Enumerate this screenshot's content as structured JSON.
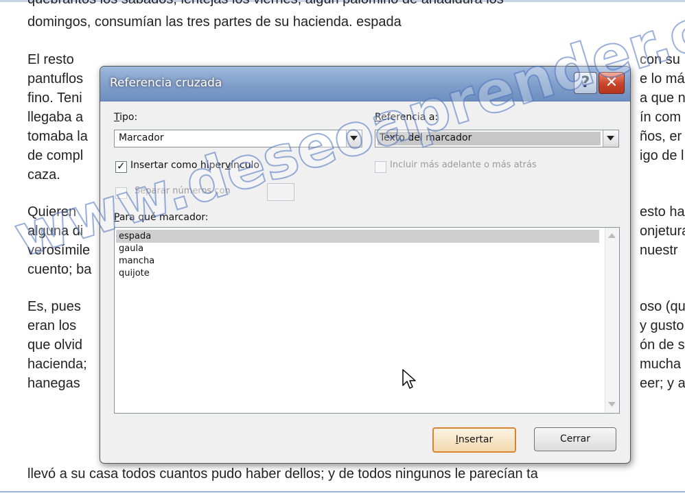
{
  "document": {
    "lines": [
      "quebrantos los sábados, lentejas los viernes, algún palomino de añadidura los",
      "domingos, consumían las tres partes de su hacienda. espada",
      "El resto",
      "con su",
      "pantuflos",
      "e lo más",
      "fino. Teni",
      "a que n",
      "llegaba a",
      "ín com",
      "tomaba la",
      "ños, er",
      "de compl",
      "igo de l",
      "caza.",
      "Quieren",
      "esto ha",
      "alguna di",
      "onjetura",
      "verosímile",
      "nuestr",
      "cuento; ba",
      "Es, pues",
      "oso (qu",
      "eran los",
      "y gusto",
      "que olvid",
      "ón de s",
      "hacienda;",
      "mucha",
      "hanegas",
      "eer; y a",
      "llevó a su casa todos cuantos pudo haber dellos; y de todos ningunos le parecían ta"
    ]
  },
  "dialog": {
    "title": "Referencia cruzada",
    "help_glyph": "?",
    "close_glyph": "✕",
    "tipo_label_first": "T",
    "tipo_label_rest": "ipo:",
    "tipo_value": "Marcador",
    "referencia_label_first": "R",
    "referencia_label_rest": "eferencia a:",
    "referencia_value": "Texto del marcador",
    "insert_hyperlink_label_a": "Insertar como hiper",
    "insert_hyperlink_label_u": "v",
    "insert_hyperlink_label_b": "ínculo",
    "insert_hyperlink_checked": "✓",
    "include_label": "Incluir más adelante o más atrás",
    "separate_label": "Separar números con",
    "para_label_first": "P",
    "para_label_rest": "ara qué marcador:",
    "bookmarks": [
      "espada",
      "gaula",
      "mancha",
      "quijote"
    ],
    "insert_button_first": "I",
    "insert_button_rest": "nsertar",
    "close_button": "Cerrar"
  },
  "watermark": "www.deseoaprender.com"
}
